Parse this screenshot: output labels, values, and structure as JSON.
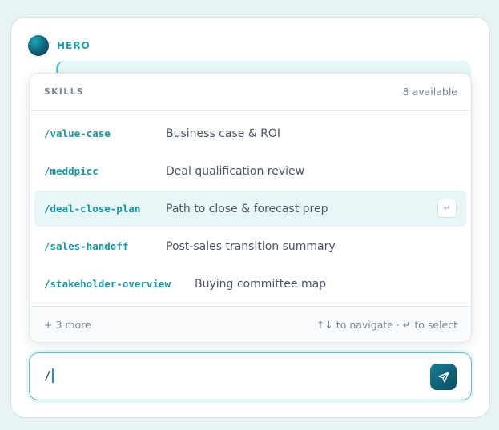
{
  "assistant": {
    "name": "HERO"
  },
  "skills_popup": {
    "title": "SKILLS",
    "count_label": "8 available",
    "items": [
      {
        "command": "/value-case",
        "description": "Business case & ROI"
      },
      {
        "command": "/meddpicc",
        "description": "Deal qualification review"
      },
      {
        "command": "/deal-close-plan",
        "description": "Path to close & forecast prep",
        "active": true
      },
      {
        "command": "/sales-handoff",
        "description": "Post-sales transition summary"
      },
      {
        "command": "/stakeholder-overview",
        "description": "Buying committee map"
      }
    ],
    "enter_hint": "↵",
    "more_label": "+ 3 more",
    "nav_hint": "↑↓ to navigate · ↵ to select"
  },
  "composer": {
    "value": "/",
    "send_icon": "send-icon"
  },
  "colors": {
    "accent": "#17a2b3",
    "active_row": "#e8f6f7",
    "send_button": "#0c4a63"
  }
}
